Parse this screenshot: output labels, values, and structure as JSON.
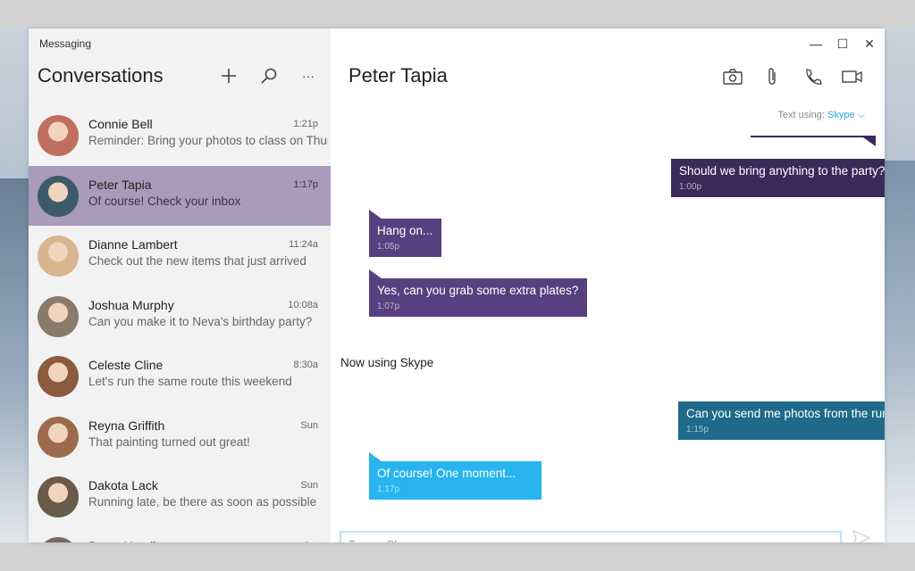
{
  "app_title": "Messaging",
  "left_header": {
    "title": "Conversations",
    "new_icon": "plus-icon",
    "search_icon": "search-icon",
    "more_icon": "more-icon",
    "more_text": "···"
  },
  "conversations": [
    {
      "name": "Connie Bell",
      "time": "1:21p",
      "preview": "Reminder: Bring your photos to class on Thursday",
      "avatar_color": "#c06f5e"
    },
    {
      "name": "Peter Tapia",
      "time": "1:17p",
      "preview": "Of course! Check your inbox",
      "avatar_color": "#3d5a69",
      "selected": true
    },
    {
      "name": "Dianne Lambert",
      "time": "11:24a",
      "preview": "Check out the new items that just arrived",
      "avatar_color": "#d8b48f"
    },
    {
      "name": "Joshua Murphy",
      "time": "10:08a",
      "preview": "Can you make it to Neva's birthday party?",
      "avatar_color": "#8a7a6a"
    },
    {
      "name": "Celeste Cline",
      "time": "8:30a",
      "preview": "Let's run the same route this weekend",
      "avatar_color": "#8c5a3c"
    },
    {
      "name": "Reyna Griffith",
      "time": "Sun",
      "preview": "That painting turned out great!",
      "avatar_color": "#9c6a4c"
    },
    {
      "name": "Dakota Lack",
      "time": "Sun",
      "preview": "Running late, be there as soon as possible",
      "avatar_color": "#6a5a4a"
    },
    {
      "name": "Bryce Hamilton",
      "time": "Sat",
      "preview": "",
      "avatar_color": "#7a6a5a"
    }
  ],
  "chat": {
    "name": "Peter Tapia",
    "actions": [
      "camera-icon",
      "attach-icon",
      "phone-icon",
      "video-icon",
      "more-icon"
    ],
    "more_text": "···",
    "text_using_label": "Text using:",
    "text_using_service": "Skype ⌵",
    "messages": [
      {
        "direction": "out",
        "text": "Should we bring anything to the party?",
        "time": "1:00p"
      },
      {
        "direction": "in",
        "text": "Hang on...",
        "time": "1:05p"
      },
      {
        "direction": "in",
        "text": "Yes, can you grab some extra plates?",
        "time": "1:07p"
      },
      {
        "direction": "out",
        "text": "Can you send me photos from the run",
        "time": "1:15p"
      },
      {
        "direction": "in",
        "text": "Of course!  One moment...",
        "time": "1:17p"
      }
    ],
    "status_text": "Now using Skype",
    "composer_placeholder": "Type a Skype message"
  },
  "window_controls": {
    "minimize": "—",
    "maximize": "☐",
    "close": "✕"
  },
  "colors": {
    "selected": "#a99bb9",
    "outgoing": "#3a2a5a",
    "incoming": "#583f7f",
    "teal": "#1f6a8a",
    "skype_blue": "#28b5ef"
  }
}
